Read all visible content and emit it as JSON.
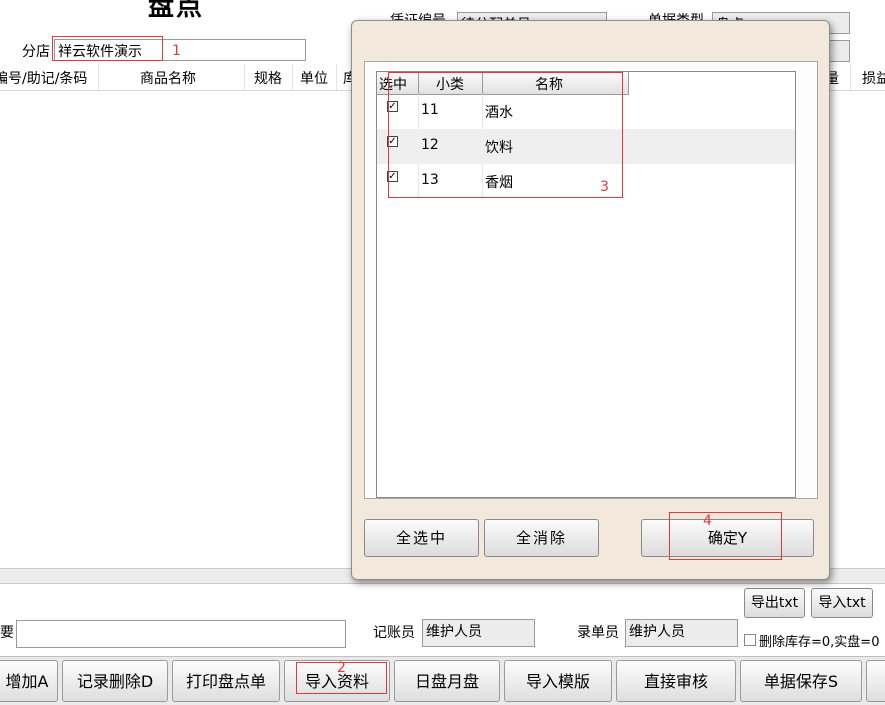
{
  "form": {
    "title": "盘点",
    "branch_label": "分店",
    "branch_value": "祥云软件演示",
    "voucher_label": "凭证编号",
    "voucher_value": "待分配单号",
    "doctype_label": "单据类型",
    "doctype_value": "盘点",
    "marker_1": "1"
  },
  "table_headers": [
    "编号/助记/条码",
    "商品名称",
    "规格",
    "单位",
    "库",
    "量",
    "损益"
  ],
  "dialog": {
    "columns": [
      "选中",
      "小类",
      "名称"
    ],
    "rows": [
      {
        "checked": true,
        "code": "11",
        "name": "酒水"
      },
      {
        "checked": true,
        "code": "12",
        "name": "饮料"
      },
      {
        "checked": true,
        "code": "13",
        "name": "香烟"
      }
    ],
    "marker_3": "3",
    "select_all_label": "全选中",
    "clear_all_label": "全消除",
    "confirm_label": "确定Y",
    "marker_4": "4"
  },
  "footer": {
    "export_txt": "导出txt",
    "import_txt": "导入txt",
    "summary_label": "要",
    "summary_value": "",
    "accountant_label": "记账员",
    "accountant_value": "维护人员",
    "recorder_label": "录单员",
    "recorder_value": "维护人员",
    "delete_stock_label": "删除库存=0,实盘=0"
  },
  "toolbar": {
    "buttons": [
      "增加A",
      "记录删除D",
      "打印盘点单",
      "导入资料",
      "日盘月盘",
      "导入模版",
      "直接审核",
      "单据保存S"
    ],
    "marker_2": "2"
  }
}
